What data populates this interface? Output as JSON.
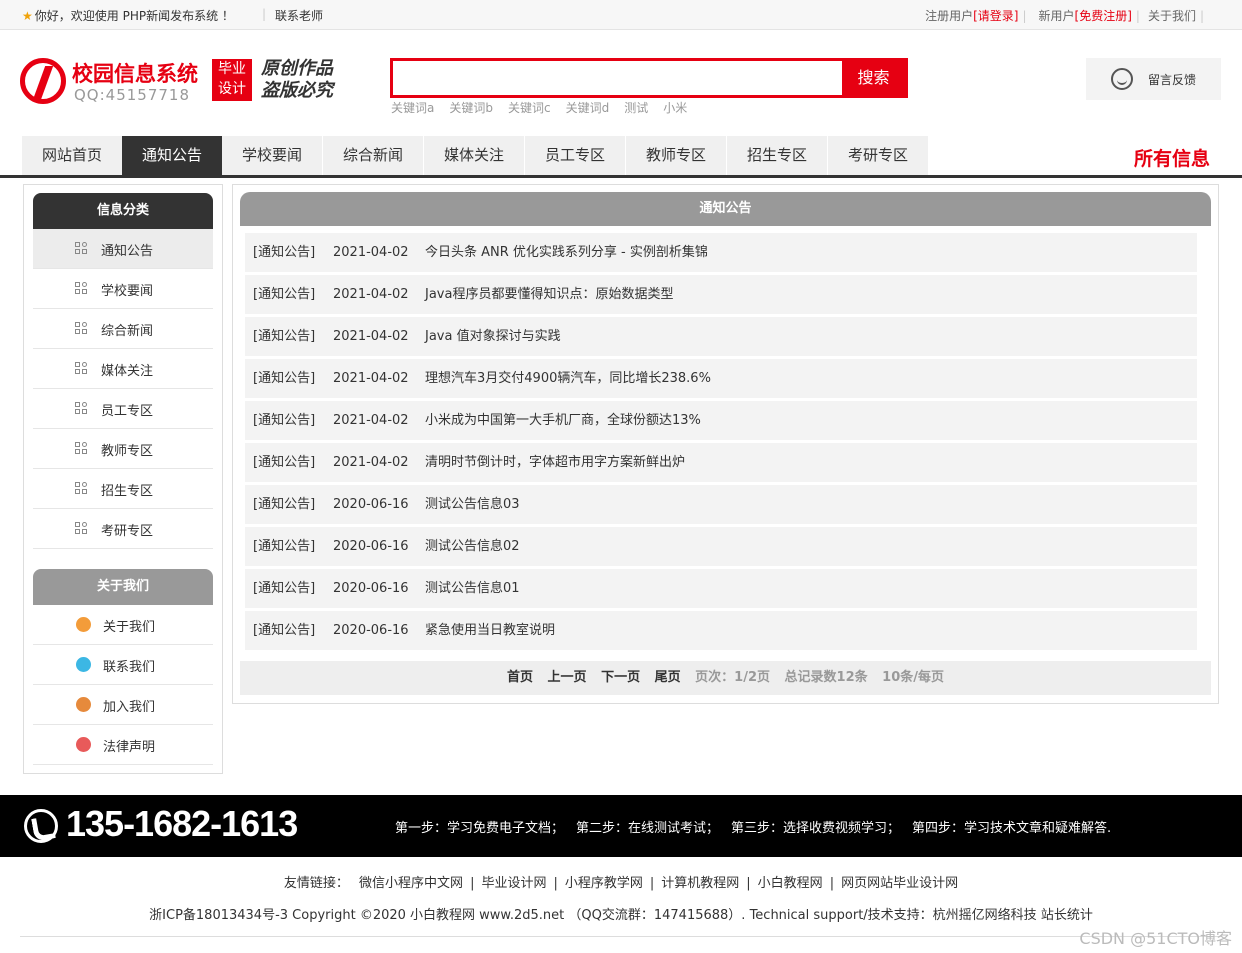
{
  "topbar": {
    "welcome": "你好，欢迎使用 PHP新闻发布系统 ！",
    "contact": "联系老师",
    "registered_prefix": "注册用户",
    "login": "[请登录]",
    "new_prefix": "新用户",
    "register": "[免费注册]",
    "about": "关于我们"
  },
  "header": {
    "logo_title": "校园信息系统",
    "logo_qq": "QQ:45157718",
    "badge_line1": "毕业",
    "badge_line2": "设计",
    "slogan_line1": "原创作品",
    "slogan_line2": "盗版必究",
    "search_placeholder": "",
    "search_button": "搜索",
    "keywords": [
      "关键词a",
      "关键词b",
      "关键词c",
      "关键词d",
      "测试",
      "小米"
    ],
    "feedback": "留言反馈"
  },
  "nav": {
    "items": [
      "网站首页",
      "通知公告",
      "学校要闻",
      "综合新闻",
      "媒体关注",
      "员工专区",
      "教师专区",
      "招生专区",
      "考研专区"
    ],
    "active_index": 1,
    "all_info": "所有信息"
  },
  "sidebar": {
    "category_title": "信息分类",
    "categories": [
      "通知公告",
      "学校要闻",
      "综合新闻",
      "媒体关注",
      "员工专区",
      "教师专区",
      "招生专区",
      "考研专区"
    ],
    "about_title": "关于我们",
    "about_items": [
      {
        "label": "关于我们",
        "icon": "info-icon",
        "color": "#f39c3a"
      },
      {
        "label": "联系我们",
        "icon": "contact-card-icon",
        "color": "#3cb7e4"
      },
      {
        "label": "加入我们",
        "icon": "lock-icon",
        "color": "#e68a3c"
      },
      {
        "label": "法律声明",
        "icon": "power-icon",
        "color": "#e85a5a"
      }
    ]
  },
  "main": {
    "title": "通知公告",
    "rows": [
      {
        "cat": "[通知公告]",
        "date": "2021-04-02",
        "title": "今日头条 ANR 优化实践系列分享 - 实例剖析集锦"
      },
      {
        "cat": "[通知公告]",
        "date": "2021-04-02",
        "title": "Java程序员都要懂得知识点：原始数据类型"
      },
      {
        "cat": "[通知公告]",
        "date": "2021-04-02",
        "title": "Java 值对象探讨与实践"
      },
      {
        "cat": "[通知公告]",
        "date": "2021-04-02",
        "title": "理想汽车3月交付4900辆汽车，同比增长238.6%"
      },
      {
        "cat": "[通知公告]",
        "date": "2021-04-02",
        "title": "小米成为中国第一大手机厂商，全球份额达13%"
      },
      {
        "cat": "[通知公告]",
        "date": "2021-04-02",
        "title": "清明时节倒计时，字体超市用字方案新鲜出炉"
      },
      {
        "cat": "[通知公告]",
        "date": "2020-06-16",
        "title": "测试公告信息03"
      },
      {
        "cat": "[通知公告]",
        "date": "2020-06-16",
        "title": "测试公告信息02"
      },
      {
        "cat": "[通知公告]",
        "date": "2020-06-16",
        "title": "测试公告信息01"
      },
      {
        "cat": "[通知公告]",
        "date": "2020-06-16",
        "title": "紧急使用当日教室说明"
      }
    ],
    "pager": {
      "first": "首页",
      "prev": "上一页",
      "next": "下一页",
      "last": "尾页",
      "page_info": "页次：1/2页",
      "total": "总记录数12条",
      "per_page": "10条/每页"
    }
  },
  "footer": {
    "phone": "135-1682-1613",
    "steps": [
      "第一步：学习免费电子文档；",
      "第二步：在线测试考试；",
      "第三步：选择收费视频学习；",
      "第四步：学习技术文章和疑难解答."
    ],
    "links_label": "友情链接：",
    "links": [
      "微信小程序中文网",
      "毕业设计网",
      "小程序教学网",
      "计算机教程网",
      "小白教程网",
      "网页网站毕业设计网"
    ],
    "copyright": "浙ICP备18013434号-3 Copyright ©2020 小白教程网 www.2d5.net （QQ交流群：147415688）. Technical support/技术支持：杭州摇亿网络科技 站长统计",
    "watermark": "CSDN @51CTO博客"
  }
}
